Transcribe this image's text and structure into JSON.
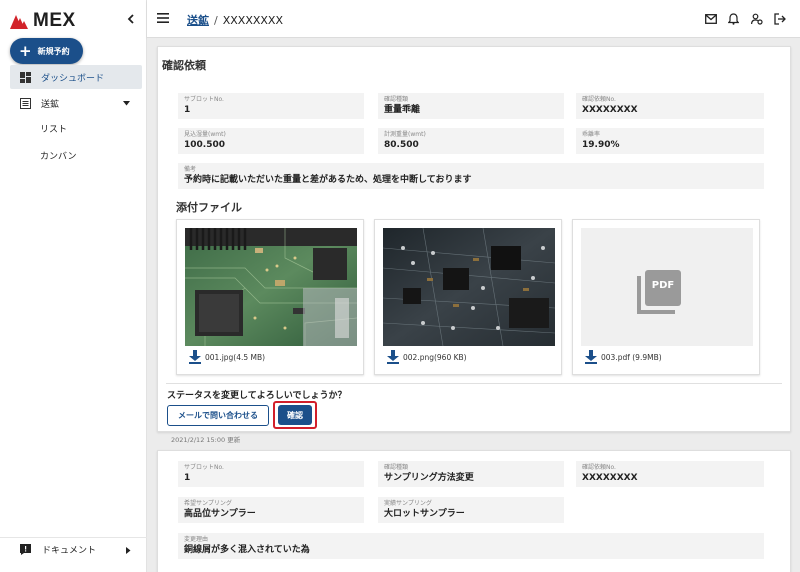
{
  "app": {
    "logo_text": "MEX"
  },
  "sidebar": {
    "new_button_label": "新規予約",
    "items": [
      {
        "label": "ダッシュボード",
        "icon": "dashboard-icon"
      },
      {
        "label": "送鉱",
        "icon": "list-icon"
      }
    ],
    "subitems": [
      "リスト",
      "カンバン"
    ],
    "document_label": "ドキュメント"
  },
  "header": {
    "breadcrumb_link": "送鉱",
    "breadcrumb_sep": "/",
    "breadcrumb_current": "XXXXXXXX"
  },
  "card1": {
    "title": "確認依頼",
    "fields": [
      {
        "label": "サブロットNo.",
        "value": "1"
      },
      {
        "label": "確認種類",
        "value": "重量乖離"
      },
      {
        "label": "確認依頼No.",
        "value": "XXXXXXXX"
      },
      {
        "label": "見込湿量(wmt)",
        "value": "100.500"
      },
      {
        "label": "計測重量(wmt)",
        "value": "80.500"
      },
      {
        "label": "乖離率",
        "value": "19.90%"
      },
      {
        "label": "備考",
        "value": "予約時に記載いただいた重量と差があるため、処理を中断しております"
      }
    ],
    "attachments_title": "添付ファイル",
    "attachments": [
      {
        "name": "001.jpg(4.5 MB)"
      },
      {
        "name": "002.png(960 KB)"
      },
      {
        "name": "003.pdf (9.9MB)"
      }
    ],
    "pdf_label": "PDF",
    "question": "ステータスを変更してよろしいでしょうか？",
    "mail_button": "メールで問い合わせる",
    "confirm_button": "確認",
    "updated": "2021/2/12 15:00 更新"
  },
  "card2": {
    "fields": [
      {
        "label": "サブロットNo.",
        "value": "1"
      },
      {
        "label": "確認種類",
        "value": "サンプリング方法変更"
      },
      {
        "label": "確認依頼No.",
        "value": "XXXXXXXX"
      },
      {
        "label": "希望サンプリング",
        "value": "高品位サンプラー"
      },
      {
        "label": "実績サンプリング",
        "value": "大ロットサンプラー"
      },
      {
        "label": "変更理由",
        "value": "銅線屑が多く混入されていた為"
      }
    ]
  },
  "colors": {
    "primary": "#1b4f8a",
    "logo_red": "#d2232a",
    "highlight": "#d21f2a"
  }
}
